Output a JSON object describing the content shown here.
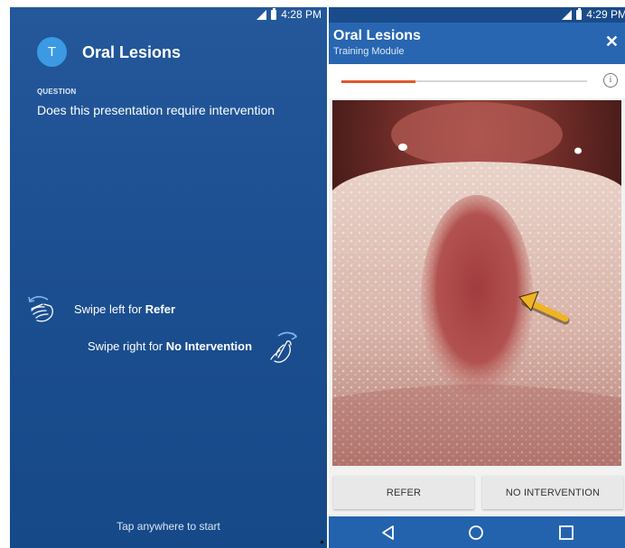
{
  "left_screen": {
    "status_time": "4:28 PM",
    "avatar_letter": "T",
    "title": "Oral Lesions",
    "question_label": "QUESTION",
    "question_text": "Does this presentation require intervention",
    "swipe_left_prefix": "Swipe left for ",
    "swipe_left_action": "Refer",
    "swipe_right_prefix": "Swipe right for ",
    "swipe_right_action": "No Intervention",
    "tap_to_start": "Tap anywhere to start",
    "icons": [
      "swipe-left-hand-icon",
      "swipe-right-hand-icon",
      "signal-icon",
      "battery-icon"
    ]
  },
  "right_screen": {
    "status_time": "4:29 PM",
    "title": "Oral Lesions",
    "subtitle": "Training Module",
    "close_symbol": "✕",
    "info_symbol": "i",
    "progress_fraction": 0.3,
    "image_subject": "tongue-lesion-photo",
    "buttons": {
      "refer": "REFER",
      "no_intervention": "NO INTERVENTION"
    },
    "nav": [
      "back-icon",
      "home-icon",
      "recent-apps-icon"
    ]
  },
  "colors": {
    "left_background": "#1c4f91",
    "header_blue": "#2866b1",
    "avatar": "#3b9ae3",
    "progress": "#e0572a",
    "button_bg": "#e8e8e8",
    "arrow": "#f0b323"
  }
}
